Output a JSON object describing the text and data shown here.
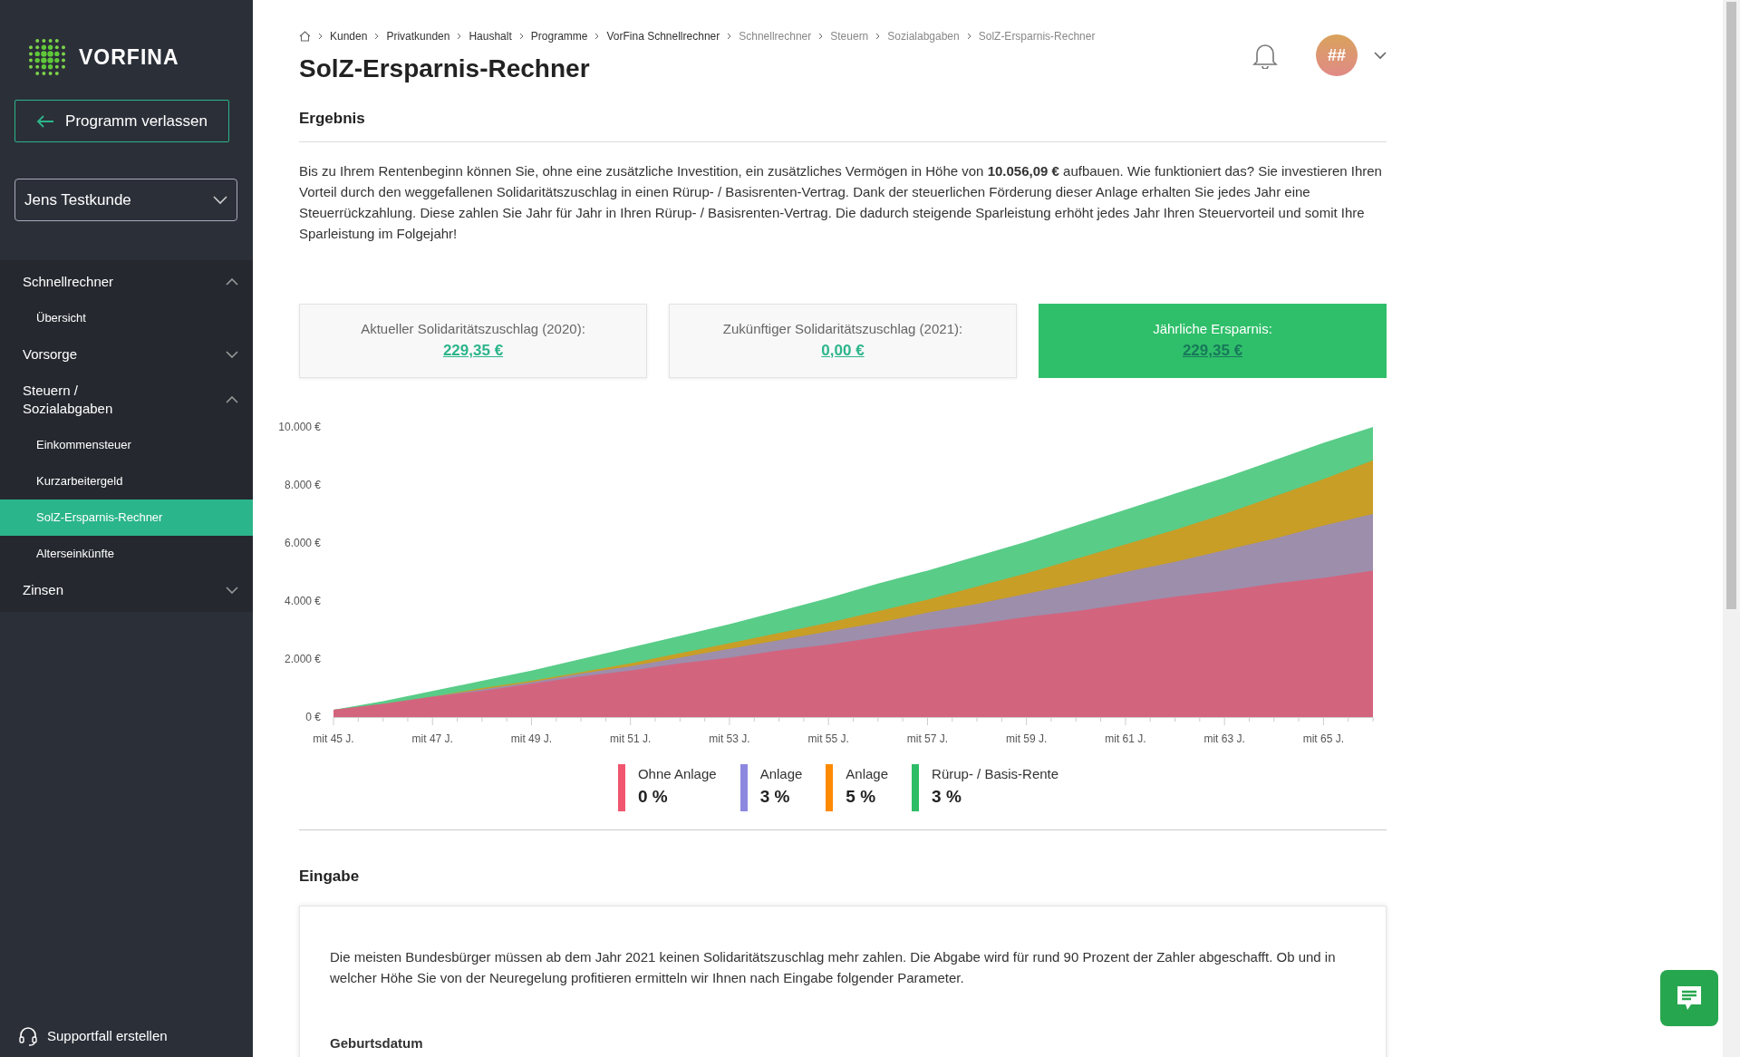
{
  "sidebar": {
    "logo": "VORFINA",
    "exit_button": "Programm verlassen",
    "customer_select": {
      "value": "Jens Testkunde"
    },
    "nav": [
      {
        "label": "Schnellrechner",
        "expanded": true,
        "children": [
          {
            "label": "Übersicht",
            "selected": false
          }
        ]
      },
      {
        "label": "Vorsorge",
        "expanded": false
      },
      {
        "label": "Steuern / Sozialabgaben",
        "expanded": true,
        "children": [
          {
            "label": "Einkommensteuer",
            "selected": false
          },
          {
            "label": "Kurzarbeitergeld",
            "selected": false
          },
          {
            "label": "SolZ-Ersparnis-Rechner",
            "selected": true
          },
          {
            "label": "Alterseinkünfte",
            "selected": false
          }
        ]
      },
      {
        "label": "Zinsen",
        "expanded": false
      }
    ],
    "support_link": "Supportfall erstellen"
  },
  "breadcrumb": [
    {
      "label": "Kunden",
      "dimmed": false
    },
    {
      "label": "Privatkunden",
      "dimmed": false
    },
    {
      "label": "Haushalt",
      "dimmed": false
    },
    {
      "label": "Programme",
      "dimmed": false
    },
    {
      "label": "VorFina Schnellrechner",
      "dimmed": false
    },
    {
      "label": "Schnellrechner",
      "dimmed": true
    },
    {
      "label": "Steuern",
      "dimmed": true
    },
    {
      "label": "Sozialabgaben",
      "dimmed": true
    },
    {
      "label": "SolZ-Ersparnis-Rechner",
      "dimmed": true
    }
  ],
  "page_title": "SolZ-Ersparnis-Rechner",
  "user": {
    "avatar": "##"
  },
  "result": {
    "heading": "Ergebnis",
    "text": "Bis zu Ihrem Rentenbeginn können Sie, ohne eine zusätzliche Investition, ein zusätzliches Vermögen in Höhe von **10.056,09 €** aufbauen. Wie funktioniert das? Sie investieren Ihren Vorteil durch den weggefallenen Solidaritätszuschlag in einen Rürup- / Basisrenten-Vertrag. Dank der steuerlichen Förderung dieser Anlage erhalten Sie jedes Jahr eine Steuerrückzahlung. Diese zahlen Sie Jahr für Jahr in Ihren Rürup- / Basisrenten-Vertrag. Die dadurch steigende Sparleistung erhöht jedes Jahr Ihren Steuervorteil und somit Ihre Sparleistung im Folgejahr!",
    "cards": [
      {
        "label": "Aktueller Solidaritätszuschlag (2020):",
        "value": "229,35 €",
        "highlighted": false
      },
      {
        "label": "Zukünftiger Solidaritätszuschlag (2021):",
        "value": "0,00 €",
        "highlighted": false
      },
      {
        "label": "Jährliche Ersparnis:",
        "value": "229,35 €",
        "highlighted": true
      }
    ],
    "chart_data": {
      "type": "area",
      "stacked": false,
      "categories": [
        "mit 45 J.",
        null,
        "mit 47 J.",
        null,
        "mit 49 J.",
        null,
        "mit 51 J.",
        null,
        "mit 53 J.",
        null,
        "mit 55 J.",
        null,
        "mit 57 J.",
        null,
        "mit 59 J.",
        null,
        "mit 61 J.",
        null,
        "mit 63 J.",
        null,
        "mit 65 J.",
        null
      ],
      "yticks": [
        {
          "value": 0,
          "label": "0 €"
        },
        {
          "value": 2000,
          "label": "2.000 €"
        },
        {
          "value": 4000,
          "label": "4.000 €"
        },
        {
          "value": 6000,
          "label": "6.000 €"
        },
        {
          "value": 8000,
          "label": "8.000 €"
        },
        {
          "value": 10000,
          "label": "10.000 €"
        }
      ],
      "ylim": [
        0,
        10000
      ],
      "series": [
        {
          "color": "#2fbf6a",
          "values": [
            250,
            550,
            900,
            1250,
            1600,
            2000,
            2400,
            2800,
            3200,
            3650,
            4100,
            4600,
            5050,
            5550,
            6050,
            6600,
            7150,
            7700,
            8250,
            8850,
            9450,
            10000
          ]
        },
        {
          "color": "#f28c00",
          "values": [
            250,
            450,
            700,
            1000,
            1250,
            1550,
            1850,
            2200,
            2550,
            2900,
            3250,
            3650,
            4050,
            4500,
            4950,
            5450,
            5950,
            6450,
            7000,
            7600,
            8200,
            8850
          ]
        },
        {
          "color": "#8c88e0",
          "values": [
            250,
            450,
            700,
            950,
            1200,
            1500,
            1750,
            2050,
            2350,
            2650,
            2950,
            3250,
            3600,
            3900,
            4250,
            4600,
            5000,
            5350,
            5750,
            6150,
            6600,
            7000
          ]
        },
        {
          "color": "#e8546c",
          "values": [
            250,
            450,
            700,
            900,
            1150,
            1400,
            1600,
            1850,
            2050,
            2300,
            2500,
            2750,
            3000,
            3200,
            3450,
            3650,
            3900,
            4150,
            4350,
            4600,
            4800,
            5050
          ]
        }
      ]
    },
    "legend": [
      {
        "label": "Ohne Anlage",
        "value": "0 %",
        "color": "#f0566f"
      },
      {
        "label": "Anlage",
        "value": "3 %",
        "color": "#8c88e0"
      },
      {
        "label": "Anlage",
        "value": "5 %",
        "color": "#ff8a00"
      },
      {
        "label": "Rürup- / Basis-Rente",
        "value": "3 %",
        "color": "#2dbd66"
      }
    ]
  },
  "input": {
    "heading": "Eingabe",
    "intro": "Die meisten Bundesbürger müssen ab dem Jahr 2021 keinen Solidaritätszuschlag mehr zahlen. Die Abgabe wird für rund 90 Prozent der Zahler abgeschafft. Ob und in welcher Höhe Sie von der Neuregelung profitieren ermitteln wir Ihnen nach Eingabe folgender Parameter.",
    "field_label": "Geburtsdatum"
  }
}
